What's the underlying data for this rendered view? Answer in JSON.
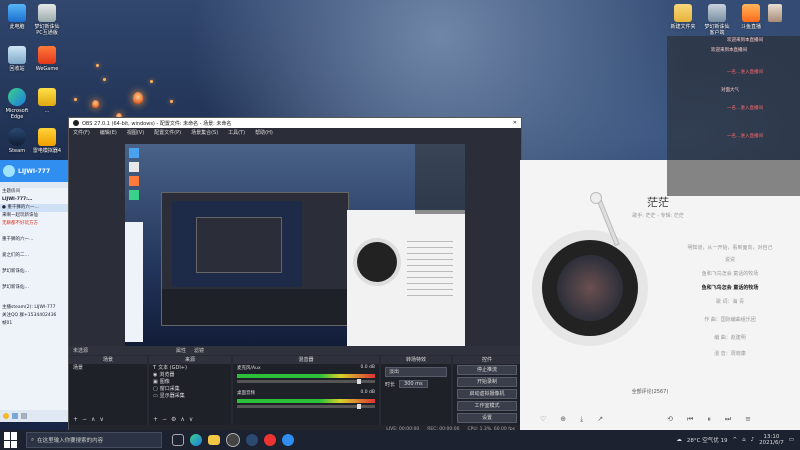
{
  "desktop": {
    "icons": [
      {
        "label": "此电脑"
      },
      {
        "label": "梦幻新诛仙\nPC互通版"
      },
      {
        "label": "回收站"
      },
      {
        "label": "WeGame"
      },
      {
        "label": "Microsoft Edge"
      },
      {
        "label": "…"
      },
      {
        "label": "Steam"
      },
      {
        "label": "雷电模拟器4"
      }
    ],
    "top_right_icons": [
      {
        "label": "新建文件夹"
      },
      {
        "label": "梦幻新诛仙\n客户端"
      },
      {
        "label": "斗鱼直播"
      }
    ]
  },
  "chat": {
    "header": "LIJWI-777",
    "lines": [
      "主题房间",
      "LIJWI-777:…",
      "● 重千狮的六一…",
      "来啊一起玩新诛仙",
      "无聊都不好玩方方",
      "重千狮的六一…",
      "爱之们的二…",
      "梦幻新诛仙…",
      "梦幻新诛仙…",
      "主播steam(2): LIJWI-777",
      "关注QQ 群+1534402436",
      "帧01"
    ]
  },
  "obs": {
    "title": "OBS 27.0.1 (64-bit, windows) - 配置文件: 未命名 - 场景: 未命名",
    "menu": [
      "文件(F)",
      "编辑(E)",
      "视图(V)",
      "配置文件(P)",
      "场景集合(S)",
      "工具(T)",
      "帮助(H)"
    ],
    "source_bar_label": "未选源",
    "properties_btn": "属性",
    "filters_btn": "滤镜",
    "docks": {
      "scenes": "场景",
      "sources": "来源",
      "mixer": "混音器",
      "transitions": "转场特效",
      "controls": "控件"
    },
    "scene_items": [
      "场景"
    ],
    "source_items": [
      "文本 (GDI+)",
      "浏览器",
      "图像",
      "窗口采集",
      "显示器采集"
    ],
    "mixer_items": [
      {
        "name": "麦克风/Aux",
        "db": "0.0 dB"
      },
      {
        "name": "桌面音频",
        "db": "0.0 dB"
      }
    ],
    "transition": {
      "type": "淡出",
      "duration_label": "时长",
      "duration": "300 ms"
    },
    "controls": [
      "停止推流",
      "开始录制",
      "启动虚拟摄像机",
      "工作室模式",
      "设置",
      "退出"
    ],
    "status": [
      "LIVE: 00:00:00",
      "REC: 00:00:00",
      "CPU: 1.3%, 60.00 fps"
    ]
  },
  "music": {
    "title": "茫茫",
    "subtitle": "歌手: 茫茫 - 专辑: 茫茫",
    "lyrics": [
      "明知道，从一开始，看到面向，对自己",
      "说说",
      "鱼和飞鸟怎会 童话的牧场",
      "鱼和飞鸟怎会 童话的牧场",
      "歌 词：海 青",
      "作 曲：国际编曲组乐团",
      "编 曲：赵建明",
      "混 音：周晓康"
    ],
    "comments": "全部评论(2567)"
  },
  "live": {
    "lines": [
      "欢迎来到本直播间",
      "欢迎来到本直播间",
      "一名…进入直播间",
      "对面大气",
      "一名…进入直播间",
      "一名…进入直播间"
    ]
  },
  "taskbar": {
    "search_placeholder": "在这里输入你要搜索的内容",
    "weather": "28°C 空气优 19",
    "time": "13:10",
    "date": "2021/6/7"
  },
  "colors": {
    "obs_bg": "#2b2e38",
    "taskbar_bg": "#1c2230",
    "chat_head": "#2f8ef0"
  }
}
